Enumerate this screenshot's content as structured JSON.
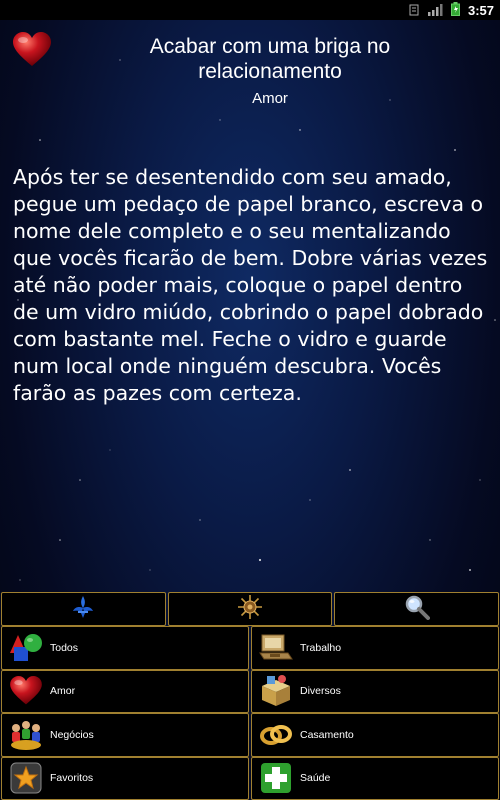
{
  "status_bar": {
    "time": "3:57"
  },
  "header": {
    "title": "Acabar com uma briga no relacionamento",
    "category": "Amor"
  },
  "content": {
    "text": "Após ter se desentendido com seu amado, pegue um pedaço de papel branco, escreva o nome dele completo e o seu mentalizando que vocês ficarão de bem. Dobre várias vezes até não poder mais, coloque o papel dentro de um vidro miúdo, cobrindo o papel dobrado com bastante mel. Feche o vidro e guarde num local onde ninguém descubra. Vocês farão as pazes com certeza."
  },
  "toolbar": {
    "items": [
      {
        "icon": "fleur-de-lis-icon"
      },
      {
        "icon": "sun-emblem-icon"
      },
      {
        "icon": "magnifier-icon"
      }
    ]
  },
  "categories": [
    {
      "label": "Todos",
      "icon": "shapes-icon"
    },
    {
      "label": "Trabalho",
      "icon": "briefcase-icon"
    },
    {
      "label": "Amor",
      "icon": "heart-icon"
    },
    {
      "label": "Diversos",
      "icon": "box-icon"
    },
    {
      "label": "Negócios",
      "icon": "people-icon"
    },
    {
      "label": "Casamento",
      "icon": "rings-icon"
    },
    {
      "label": "Favoritos",
      "icon": "star-icon"
    },
    {
      "label": "Saúde",
      "icon": "health-cross-icon"
    }
  ],
  "colors": {
    "button_border": "#a08030",
    "button_bg": "#000000",
    "heart": "#c8141e",
    "accent_blue": "#1e5cd0"
  }
}
